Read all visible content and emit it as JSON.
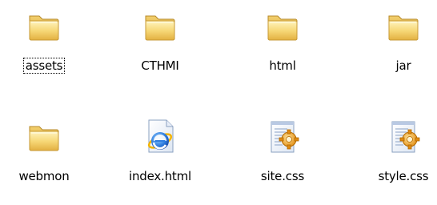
{
  "files": [
    {
      "label": "assets",
      "icon": "folder-icon"
    },
    {
      "label": "CTHMI",
      "icon": "folder-icon"
    },
    {
      "label": "html",
      "icon": "folder-icon"
    },
    {
      "label": "jar",
      "icon": "folder-icon"
    },
    {
      "label": "webmon",
      "icon": "folder-icon"
    },
    {
      "label": "index.html",
      "icon": "html-file-icon"
    },
    {
      "label": "site.css",
      "icon": "css-file-icon"
    },
    {
      "label": "style.css",
      "icon": "css-file-icon"
    }
  ],
  "focused_item": "assets",
  "colors": {
    "folder_front": "#f7d36e",
    "folder_back": "#e9b94a",
    "ie_blue": "#2b6fd6",
    "css_gear": "#f0a21c"
  }
}
